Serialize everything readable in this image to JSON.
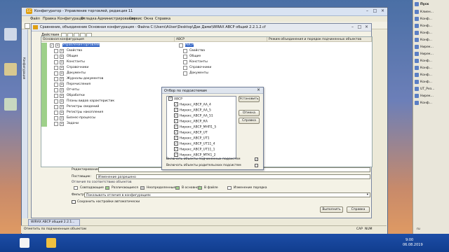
{
  "app": {
    "title": "Конфигуратор - Управление торговлей, редакция 11",
    "menu": [
      "Файл",
      "Правка",
      "Конфигурация",
      "Отладка",
      "Администрирование",
      "Сервис",
      "Окна",
      "Справка"
    ],
    "side_tab": "Конфигурация",
    "status_text": "Отметить по подчиненным объектам",
    "status_cap": "CAP",
    "status_num": "NUM",
    "status_lang": "ru"
  },
  "compare": {
    "title": "Сравнение, объединение Основная конфигурация - Файла C:\\Users\\AUser\\Desktop\\Дак Дами\\WIRAX АВСР общий 2.2.1.2.cf",
    "actions_label": "Действия",
    "col_left": "Основная конфигурация",
    "col_right": "АВСР",
    "col_mode": "Режим объединения и порядок подчиненных объектов",
    "left_items": [
      "УправлениеТорговлей",
      "Свойства",
      "Общие",
      "Константы",
      "Справочники",
      "Документы",
      "Журналы документов",
      "Перечисления",
      "Отчеты",
      "Обработки",
      "Планы видов характеристик",
      "Регистры сведений",
      "Регистры накопления",
      "Бизнес-процессы",
      "Задачи"
    ],
    "right_items": [
      "АВСР",
      "Свойства",
      "Общие",
      "Константы",
      "Справочники",
      "Документы"
    ],
    "label_edit": "Редактирование:",
    "label_supplier": "Поставщик:",
    "supplier_value": "Изменение разрешено",
    "group_legend": "Отличия по соответствию объектов",
    "legend": [
      "Совпадающие",
      "Различающиеся",
      "Неопределенные",
      "В основной",
      "В файле",
      "Изменение порядка"
    ],
    "label_filter": "Фильтр:",
    "filter_value": "Показывать отличия в конфигурациях",
    "save_settings": "Сохранить настройки автоматически",
    "btn_run": "Выполнить",
    "btn_help": "Справка"
  },
  "filter_dialog": {
    "title": "Отбор по подсистемам",
    "items": [
      "АВСР",
      "Нирекс_АВСР_АА_4",
      "Нирекс_АВСР_АА_5",
      "Нирекс_АВСР_АА_51",
      "Нирекс_АВСР_КА",
      "Нирекс_АВСР_МНП1_5",
      "Нирекс_АВСР_UT",
      "Нирекс_АВСР_UT1",
      "Нирекс_АВСР_UT11_4",
      "Нирекс_АВСР_UT11_1",
      "Нирекс_АВСР_МТК1_2"
    ],
    "btn_set": "Установить",
    "btn_cancel": "Отмена",
    "btn_help": "Справка",
    "opt_children": "Включать объекты подчиненных подсистем",
    "opt_parents": "Включать объекты родительских подсистем"
  },
  "taskbar": {
    "tab_label": "WIRAX АВСР общий 2.2.1...",
    "time": "9:00",
    "date": "06.08.2019"
  },
  "right_panel": {
    "start": "Пуск",
    "items": [
      "Клиен...",
      "Конф...",
      "Конф...",
      "Конф...",
      "Конф...",
      "Нирек...",
      "Нирек...",
      "Конф...",
      "Конф...",
      "Конф...",
      "Конф...",
      "UT_Рез...",
      "Нирек...",
      "Конф..."
    ]
  },
  "colors": {
    "match_green": "#9ed08a",
    "selection_blue": "#3163c4",
    "taskbar_blue": "#1c4da6"
  }
}
